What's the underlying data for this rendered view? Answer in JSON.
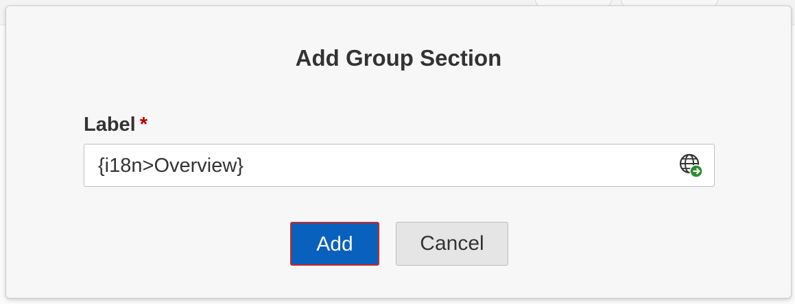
{
  "dialog": {
    "title": "Add Group Section",
    "field": {
      "label": "Label",
      "required_marker": "*",
      "value": "{i18n>Overview}",
      "icon": "globe-translate-icon"
    },
    "buttons": {
      "add_label": "Add",
      "cancel_label": "Cancel"
    }
  },
  "colors": {
    "primary_button": "#0a60bd",
    "focus_outline": "#d0261f",
    "required": "#bb0000",
    "translate_badge": "#2e8b2e"
  }
}
